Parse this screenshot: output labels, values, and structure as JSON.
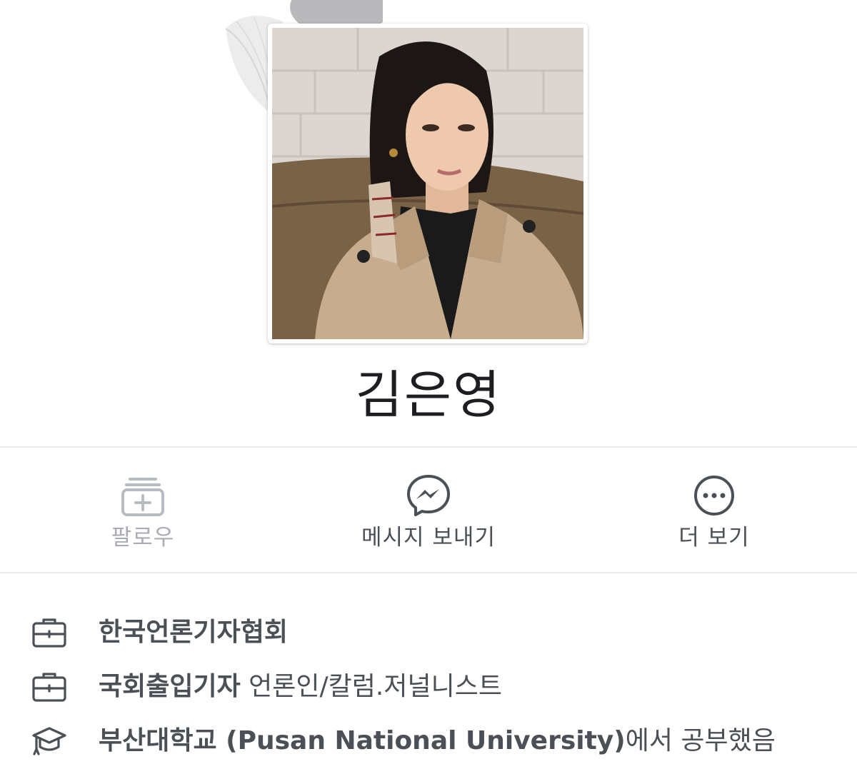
{
  "profile": {
    "name": "김은영"
  },
  "actions": [
    {
      "label": "팔로우",
      "icon": "follow-icon",
      "enabled": false
    },
    {
      "label": "메시지 보내기",
      "icon": "messenger-icon",
      "enabled": true
    },
    {
      "label": "더 보기",
      "icon": "more-icon",
      "enabled": true
    }
  ],
  "info": [
    {
      "icon": "briefcase-icon",
      "bold": "한국언론기자협회",
      "rest": ""
    },
    {
      "icon": "briefcase-icon",
      "bold": "국회출입기자",
      "rest": " 언론인/칼럼.저널니스트"
    },
    {
      "icon": "graduation-cap-icon",
      "bold": "부산대학교 (Pusan National University)",
      "rest": "에서 공부했음"
    }
  ],
  "colors": {
    "text_primary": "#1c1e21",
    "text_secondary": "#4b4f56",
    "text_disabled": "#a9adb3",
    "divider": "#e9ebee",
    "icon": "#4b4f56"
  }
}
